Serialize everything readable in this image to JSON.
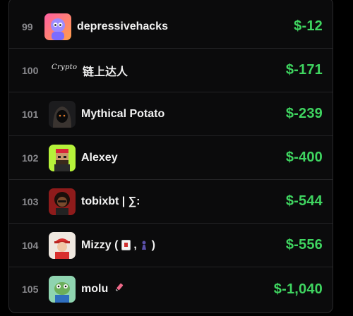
{
  "rows": [
    {
      "rank": "99",
      "name": "depressivehacks",
      "pnl": "$-12"
    },
    {
      "rank": "100",
      "name": "链上达人",
      "logo_text": "Crypto",
      "pnl": "$-171"
    },
    {
      "rank": "101",
      "name": "Mythical Potato",
      "pnl": "$-239"
    },
    {
      "rank": "102",
      "name": "Alexey",
      "pnl": "$-400"
    },
    {
      "rank": "103",
      "name": "tobixbt | ∑:",
      "pnl": "$-544"
    },
    {
      "rank": "104",
      "name_prefix": "Mizzy ( ",
      "name_mid": " , ",
      "name_suffix": " )",
      "pnl": "$-556"
    },
    {
      "rank": "105",
      "name": "molu",
      "pnl": "$-1,040"
    }
  ],
  "colors": {
    "pnl_negative": "#3fd560",
    "background": "#0b0b0c"
  }
}
